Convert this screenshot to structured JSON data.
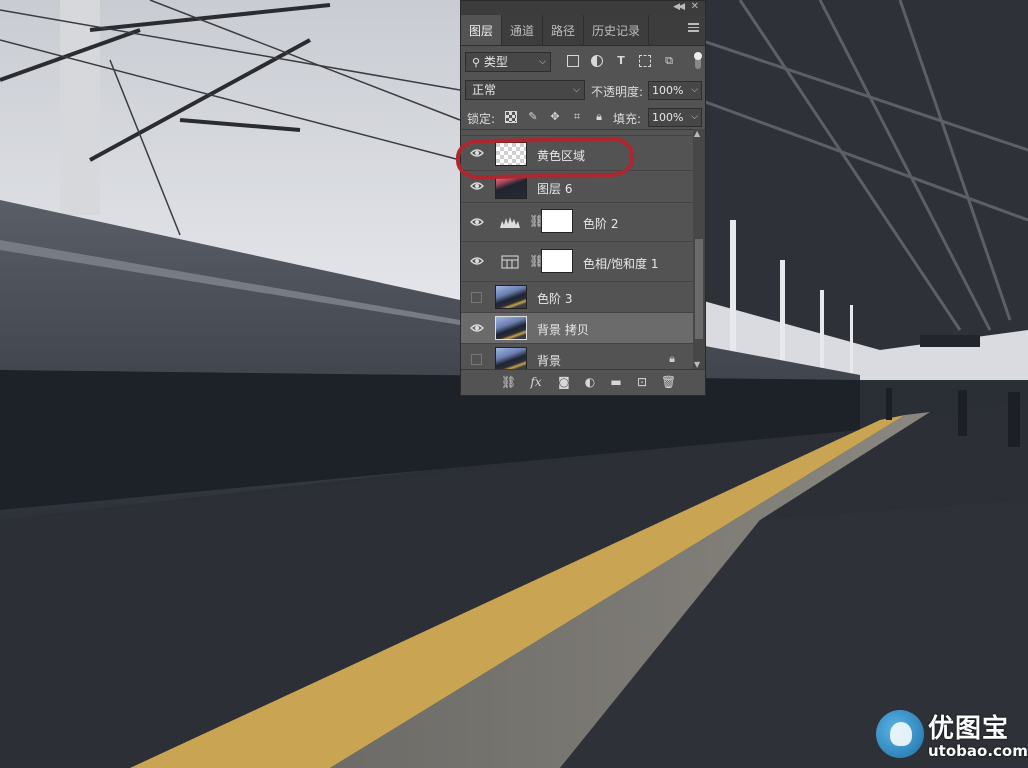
{
  "panel": {
    "tabs": [
      "图层",
      "通道",
      "路径",
      "历史记录"
    ],
    "active_tab": 0,
    "filter": {
      "kind_label": "类型"
    },
    "blend": {
      "mode": "正常",
      "opacity_label": "不透明度:",
      "opacity_value": "100%"
    },
    "lock": {
      "label": "锁定:",
      "fill_label": "填充:",
      "fill_value": "100%"
    },
    "layers": [
      {
        "name": "黄色区域",
        "visible": true,
        "thumb": "transparent",
        "selected": false
      },
      {
        "name": "图层 6",
        "visible": true,
        "thumb": "photo-pink",
        "selected": false
      },
      {
        "name": "色阶 2",
        "visible": true,
        "thumb": "levels-adjustment",
        "mask": true,
        "selected": false
      },
      {
        "name": "色相/饱和度 1",
        "visible": true,
        "thumb": "hue-saturation-adjustment",
        "mask": true,
        "selected": false
      },
      {
        "name": "色阶 3",
        "visible": false,
        "thumb": "photo",
        "selected": false
      },
      {
        "name": "背景 拷贝",
        "visible": true,
        "thumb": "photo",
        "selected": true
      },
      {
        "name": "背景",
        "visible": false,
        "thumb": "photo",
        "locked": true,
        "selected": false
      }
    ]
  },
  "watermark": {
    "brand": "优图宝",
    "url": "utobao.com"
  },
  "highlight_color": "#b0262e"
}
